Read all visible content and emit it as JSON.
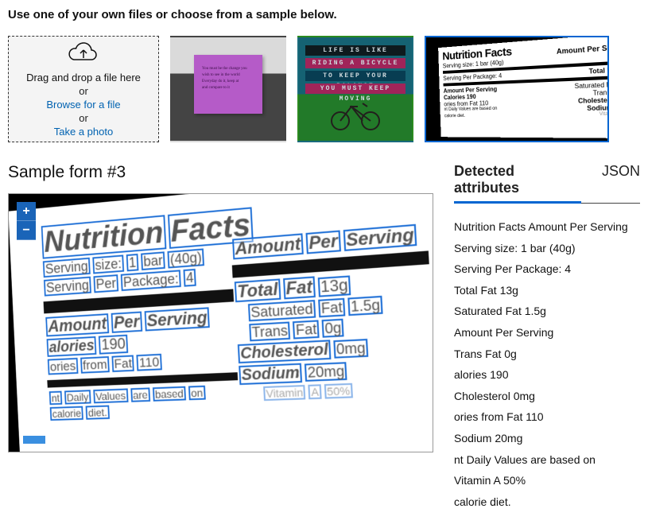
{
  "instruction": "Use one of your own files or choose from a sample below.",
  "dropzone": {
    "line1": "Drag and drop a file here",
    "or": "or",
    "browse": "Browse for a file",
    "take_photo": "Take a photo"
  },
  "samples": {
    "s2": {
      "l1": "LIFE IS LIKE",
      "l2": "RIDING A BICYCLE",
      "l3": "TO KEEP YOUR BALANCE",
      "l4": "YOU MUST KEEP MOVING"
    },
    "s3": {
      "title": "Nutrition Facts",
      "aps": "Amount Per Serving",
      "serv_size": "Serving size: 1 bar (40g)",
      "serv_pkg": "Serving Per Package: 4",
      "total_fat": "Total Fat 13g",
      "sat_fat": "Saturated Fat 1.5g",
      "calories": "Calories 190",
      "trans": "Trans Fat 0g",
      "from_fat": "ories from Fat 110",
      "chol": "Cholesterol 0mg",
      "dv": "nt Daily Values are based on",
      "sodium": "Sodium 20mg",
      "cal_diet": "calorie diet.",
      "vita": "Vitamin A 50%"
    }
  },
  "sample_title": "Sample form #3",
  "viewer": {
    "words": {
      "nutrition": "Nutrition",
      "facts": "Facts",
      "serving": "Serving",
      "size": "size:",
      "one": "1",
      "bar": "bar",
      "forty": "(40g)",
      "per": "Per",
      "package": "Package:",
      "four": "4",
      "amount": "Amount",
      "per2": "Per",
      "serving2": "Serving",
      "alories": "alories",
      "n190": "190",
      "ories": "ories",
      "from": "from",
      "fat": "Fat",
      "n110": "110",
      "nt": "nt",
      "daily": "Daily",
      "values": "Values",
      "are": "are",
      "based": "based",
      "on": "on",
      "calorie": "calorie",
      "diet": "diet.",
      "amount2": "Amount",
      "per3": "Per",
      "serving3": "Serving",
      "total": "Total",
      "fat2": "Fat",
      "n13g": "13g",
      "saturated": "Saturated",
      "fat3": "Fat",
      "n15g": "1.5g",
      "trans": "Trans",
      "fat4": "Fat",
      "n0g": "0g",
      "cholesterol": "Cholesterol",
      "n0mg": "0mg",
      "sodium": "Sodium",
      "n20mg": "20mg",
      "vitamin": "Vitamin",
      "a": "A",
      "n50": "50%"
    }
  },
  "tabs": {
    "detected": "Detected attributes",
    "json": "JSON"
  },
  "results": [
    "Nutrition Facts Amount Per Serving",
    "Serving size: 1 bar (40g)",
    "Serving Per Package: 4",
    "Total Fat 13g",
    "Saturated Fat 1.5g",
    "Amount Per Serving",
    "Trans Fat 0g",
    "alories 190",
    "Cholesterol 0mg",
    "ories from Fat 110",
    "Sodium 20mg",
    "nt Daily Values are based on",
    "Vitamin A 50%",
    "calorie diet."
  ]
}
